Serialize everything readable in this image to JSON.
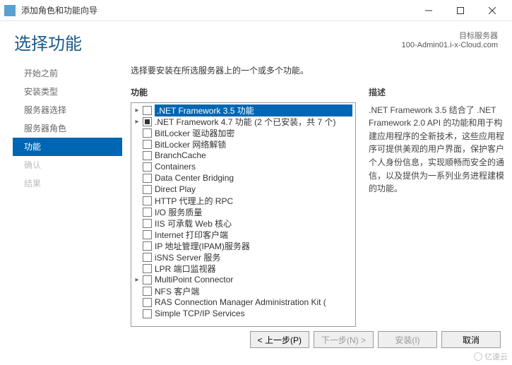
{
  "window": {
    "title": "添加角色和功能向导"
  },
  "page": {
    "title": "选择功能",
    "target_label": "目标服务器",
    "target_server": "100-Admin01.i-x-Cloud.com",
    "instruction": "选择要安装在所选服务器上的一个或多个功能。"
  },
  "sidebar": {
    "items": [
      {
        "label": "开始之前"
      },
      {
        "label": "安装类型"
      },
      {
        "label": "服务器选择"
      },
      {
        "label": "服务器角色"
      },
      {
        "label": "功能",
        "active": true
      },
      {
        "label": "确认",
        "disabled": true
      },
      {
        "label": "结果",
        "disabled": true
      }
    ]
  },
  "features": {
    "label": "功能",
    "items": [
      {
        "label": ".NET Framework 3.5 功能",
        "expandable": true,
        "checked": false,
        "selected": true
      },
      {
        "label": ".NET Framework 4.7 功能 (2 个已安装，共 7 个)",
        "expandable": true,
        "checked": "mixed"
      },
      {
        "label": "BitLocker 驱动器加密",
        "checked": false
      },
      {
        "label": "BitLocker 网络解锁",
        "checked": false
      },
      {
        "label": "BranchCache",
        "checked": false
      },
      {
        "label": "Containers",
        "checked": false
      },
      {
        "label": "Data Center Bridging",
        "checked": false
      },
      {
        "label": "Direct Play",
        "checked": false
      },
      {
        "label": "HTTP 代理上的 RPC",
        "checked": false
      },
      {
        "label": "I/O 服务质量",
        "checked": false
      },
      {
        "label": "IIS 可承载 Web 核心",
        "checked": false
      },
      {
        "label": "Internet 打印客户端",
        "checked": false
      },
      {
        "label": "IP 地址管理(IPAM)服务器",
        "checked": false
      },
      {
        "label": "iSNS Server 服务",
        "checked": false
      },
      {
        "label": "LPR 端口监视器",
        "checked": false
      },
      {
        "label": "MultiPoint Connector",
        "expandable": true,
        "checked": false
      },
      {
        "label": "NFS 客户端",
        "checked": false
      },
      {
        "label": "RAS Connection Manager Administration Kit (",
        "checked": false
      },
      {
        "label": "Simple TCP/IP Services",
        "checked": false
      }
    ]
  },
  "description": {
    "label": "描述",
    "text": ".NET Framework 3.5 结合了 .NET Framework 2.0 API 的功能和用于构建应用程序的全新技术，这些应用程序可提供美观的用户界面，保护客户个人身份信息，实现顺畅而安全的通信，以及提供为一系列业务进程建模的功能。"
  },
  "buttons": {
    "prev": "< 上一步(P)",
    "next": "下一步(N) >",
    "install": "安装(I)",
    "cancel": "取消"
  },
  "watermark": "亿速云"
}
